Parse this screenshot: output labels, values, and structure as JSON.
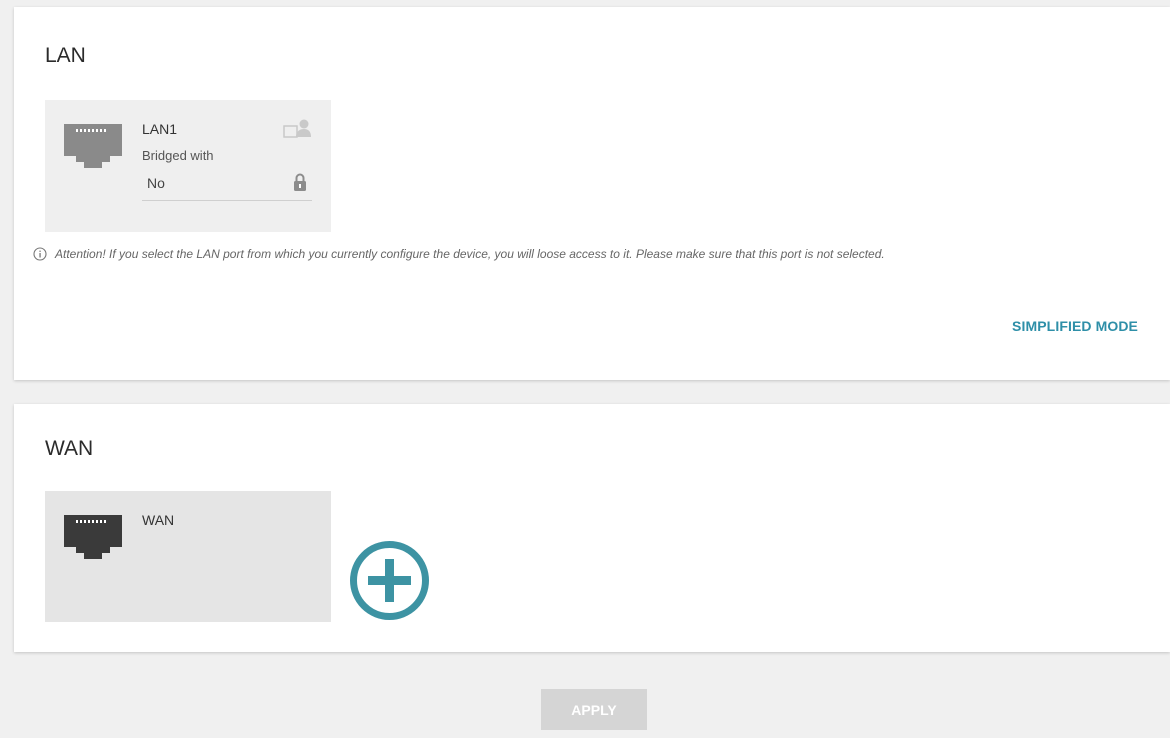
{
  "lan": {
    "title": "LAN",
    "port": {
      "name": "LAN1",
      "bridged_label": "Bridged with",
      "bridged_value": "No",
      "icon": "ethernet-port-icon",
      "user_icon": "user-connection-icon",
      "lock_icon": "lock-icon"
    },
    "attention": "Attention! If you select the LAN port from which you currently configure the device, you will loose access to it. Please make sure that this port is not selected.",
    "simplified_mode": "SIMPLIFIED MODE"
  },
  "wan": {
    "title": "WAN",
    "port": {
      "name": "WAN",
      "icon": "ethernet-port-icon"
    },
    "add_icon": "plus-circle-icon"
  },
  "apply_label": "APPLY",
  "colors": {
    "accent": "#2e8fa8",
    "add_button": "#3d93a3",
    "port_lan": "#8a8a8a",
    "port_wan": "#3a3a3a",
    "apply_disabled": "#d5d5d5"
  }
}
